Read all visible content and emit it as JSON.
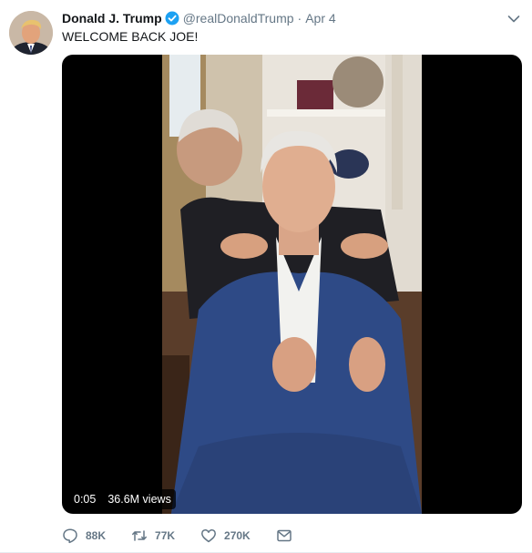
{
  "tweet": {
    "author_name": "Donald J. Trump",
    "handle": "@realDonaldTrump",
    "separator": "·",
    "date": "Apr 4",
    "text": "WELCOME BACK JOE!"
  },
  "video": {
    "duration": "0:05",
    "views": "36.6M views"
  },
  "actions": {
    "replies": "88K",
    "retweets": "77K",
    "likes": "270K"
  },
  "colors": {
    "verified": "#1da1f2",
    "secondary_text": "#657786",
    "primary_text": "#14171a"
  },
  "icons": [
    "verified-badge-icon",
    "chevron-down-icon",
    "reply-icon",
    "retweet-icon",
    "like-icon",
    "dm-icon"
  ]
}
